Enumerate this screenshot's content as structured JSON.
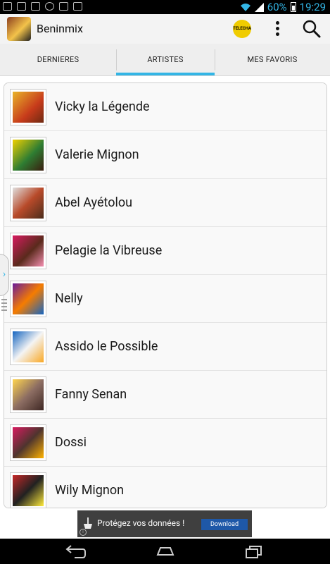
{
  "status_bar": {
    "battery": "60%",
    "time": "19:29"
  },
  "app": {
    "title": "Beninmix",
    "promo_badge": "TELECHARGER"
  },
  "tabs": [
    {
      "label": "DERNIERES",
      "selected": false
    },
    {
      "label": "ARTISTES",
      "selected": true
    },
    {
      "label": "MES FAVORIS",
      "selected": false
    }
  ],
  "artists": [
    {
      "name": "Vicky la Légende"
    },
    {
      "name": "Valerie Mignon"
    },
    {
      "name": "Abel Ayétolou"
    },
    {
      "name": "Pelagie la Vibreuse"
    },
    {
      "name": "Nelly"
    },
    {
      "name": "Assido le Possible"
    },
    {
      "name": "Fanny Senan"
    },
    {
      "name": "Dossi"
    },
    {
      "name": "Wily Mignon"
    }
  ],
  "ad": {
    "text": "Protégez vos données !",
    "button": "Download",
    "info": "i"
  },
  "colors": {
    "accent": "#33b5e5",
    "tab_bg": "#eeeeee",
    "ad_button": "#1e58a8"
  },
  "icons": {
    "status_left": [
      "gmail-icon",
      "voicemail-icon",
      "image-icon",
      "whatsapp-icon",
      "chat-icon",
      "missed-call-icon"
    ],
    "status_right": [
      "wifi-icon",
      "signal-icon",
      "battery-icon"
    ],
    "nav": [
      "back-icon",
      "home-icon",
      "recents-icon"
    ]
  }
}
